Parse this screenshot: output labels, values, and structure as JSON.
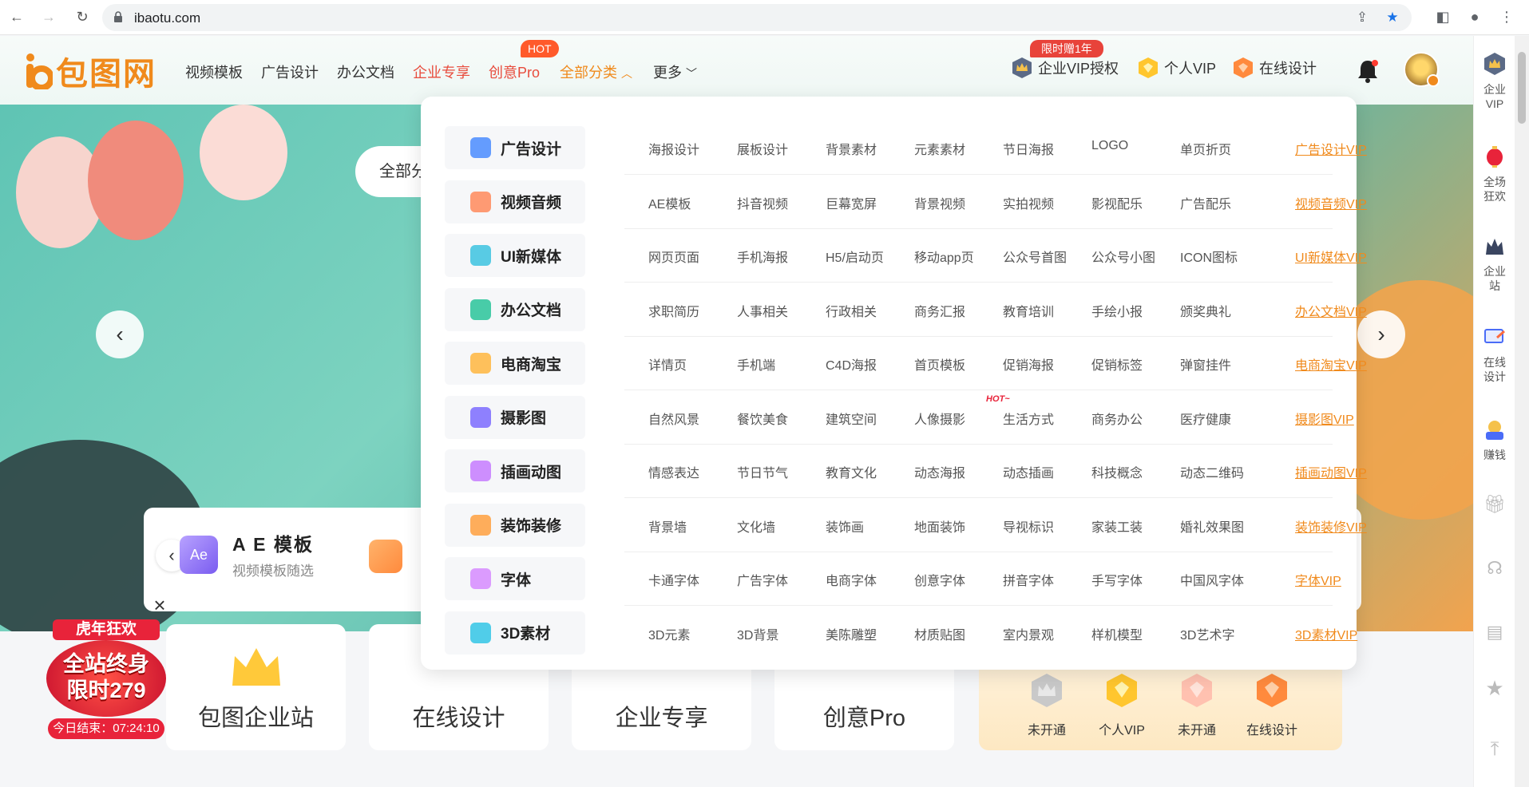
{
  "browser": {
    "url": "ibaotu.com"
  },
  "header": {
    "logo_text": "包图网",
    "nav": [
      "视频模板",
      "广告设计",
      "办公文档",
      "企业专享",
      "创意Pro",
      "全部分类",
      "更多"
    ],
    "hot_badge": "HOT",
    "promo_badge": "限时赠1年",
    "enterprise_vip": "企业VIP授权",
    "personal_vip": "个人VIP",
    "online_design": "在线设计"
  },
  "sidebar": {
    "items": [
      {
        "label": "企业\nVIP",
        "icon": "enterprise-vip-icon"
      },
      {
        "label": "全场\n狂欢",
        "icon": "lantern-icon"
      },
      {
        "label": "企业\n站",
        "icon": "enterprise-site-icon"
      },
      {
        "label": "在线\n设计",
        "icon": "online-design-icon"
      },
      {
        "label": "赚钱",
        "icon": "earn-money-icon"
      }
    ]
  },
  "hero": {
    "search_text": "全部分",
    "ae_title": "A E 模板",
    "ae_subtitle": "视频模板随选",
    "ae_icon_text": "Ae"
  },
  "bottom_cards": [
    "包图企业站",
    "在线设计",
    "企业专享",
    "创意Pro"
  ],
  "vip_panel": [
    "未开通",
    "个人VIP",
    "未开通",
    "在线设计"
  ],
  "promo": {
    "top": "虎年狂欢",
    "middle_line1": "全站终身",
    "middle_line2": "限时279",
    "bottom": "今日结束：07:24:10"
  },
  "dropdown": {
    "hot_tag": "HOT~",
    "rows": [
      {
        "name": "广告设计",
        "items": [
          "海报设计",
          "展板设计",
          "背景素材",
          "元素素材",
          "节日海报",
          "LOGO",
          "单页折页"
        ],
        "vip": "广告设计VIP",
        "color": "#4a8cff"
      },
      {
        "name": "视频音频",
        "items": [
          "AE模板",
          "抖音视频",
          "巨幕宽屏",
          "背景视频",
          "实拍视频",
          "影视配乐",
          "广告配乐"
        ],
        "vip": "视频音频VIP",
        "color": "#ff8a5c"
      },
      {
        "name": "UI新媒体",
        "items": [
          "网页页面",
          "手机海报",
          "H5/启动页",
          "移动app页",
          "公众号首图",
          "公众号小图",
          "ICON图标"
        ],
        "vip": "UI新媒体VIP",
        "color": "#3cc3e0"
      },
      {
        "name": "办公文档",
        "items": [
          "求职简历",
          "人事相关",
          "行政相关",
          "商务汇报",
          "教育培训",
          "手绘小报",
          "颁奖典礼"
        ],
        "vip": "办公文档VIP",
        "color": "#29c49a"
      },
      {
        "name": "电商淘宝",
        "items": [
          "详情页",
          "手机端",
          "C4D海报",
          "首页模板",
          "促销海报",
          "促销标签",
          "弹窗挂件"
        ],
        "vip": "电商淘宝VIP",
        "color": "#ffb640"
      },
      {
        "name": "摄影图",
        "items": [
          "自然风景",
          "餐饮美食",
          "建筑空间",
          "人像摄影",
          "生活方式",
          "商务办公",
          "医疗健康"
        ],
        "vip": "摄影图VIP",
        "color": "#7b6bff"
      },
      {
        "name": "插画动图",
        "items": [
          "情感表达",
          "节日节气",
          "教育文化",
          "动态海报",
          "动态插画",
          "科技概念",
          "动态二维码"
        ],
        "vip": "插画动图VIP",
        "color": "#c57bff"
      },
      {
        "name": "装饰装修",
        "items": [
          "背景墙",
          "文化墙",
          "装饰画",
          "地面装饰",
          "导视标识",
          "家装工装",
          "婚礼效果图"
        ],
        "vip": "装饰装修VIP",
        "color": "#ffa040"
      },
      {
        "name": "字体",
        "items": [
          "卡通字体",
          "广告字体",
          "电商字体",
          "创意字体",
          "拼音字体",
          "手写字体",
          "中国风字体"
        ],
        "vip": "字体VIP",
        "color": "#d68bff"
      },
      {
        "name": "3D素材",
        "items": [
          "3D元素",
          "3D背景",
          "美陈雕塑",
          "材质贴图",
          "室内景观",
          "样机模型",
          "3D艺术字"
        ],
        "vip": "3D素材VIP",
        "color": "#33c6e6"
      }
    ]
  }
}
